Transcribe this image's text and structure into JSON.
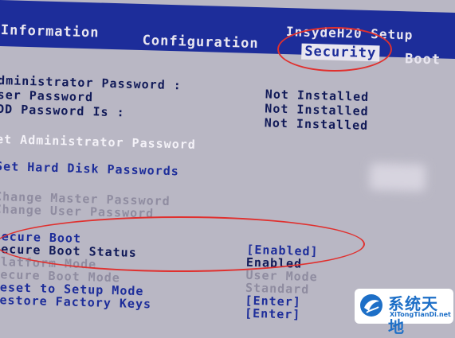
{
  "header": {
    "tabs": [
      {
        "label": "Information"
      },
      {
        "label": "Configuration"
      },
      {
        "label": "Security"
      },
      {
        "label": "Boot"
      }
    ],
    "title": "InsydeH20 Setup"
  },
  "security": {
    "status_rows": [
      {
        "label": "dministrator Password :",
        "value": "Not Installed"
      },
      {
        "label": "ser Password",
        "value": "Not Installed"
      },
      {
        "label": "DD Password Is :",
        "value": "Not Installed"
      }
    ],
    "set_admin_password": "et Administrator Password",
    "set_hdd_passwords": "Set Hard Disk Passwords",
    "change_master_password": "Change Master Password",
    "change_user_password": "Change User Password",
    "secure_boot": {
      "label": "Secure Boot",
      "value": "[Enabled]"
    },
    "secure_boot_status": {
      "label": "Secure Boot Status",
      "value": "Enabled"
    },
    "platform_mode": {
      "label": "Platform Mode",
      "value": "User Mode"
    },
    "secure_boot_mode": {
      "label": "Secure Boot Mode",
      "value": "Standard"
    },
    "reset_setup_mode": {
      "label": "Reset to Setup Mode",
      "value": "[Enter]"
    },
    "restore_factory_keys": {
      "label": "Restore Factory Keys",
      "value": "[Enter]"
    }
  },
  "watermark": {
    "name": "系统天地",
    "site": "XiTongTianDi.net"
  },
  "colors": {
    "bios_blue": "#1d2d9a",
    "panel_gray": "#b9b7c4",
    "annotation_red": "#e0302e"
  }
}
